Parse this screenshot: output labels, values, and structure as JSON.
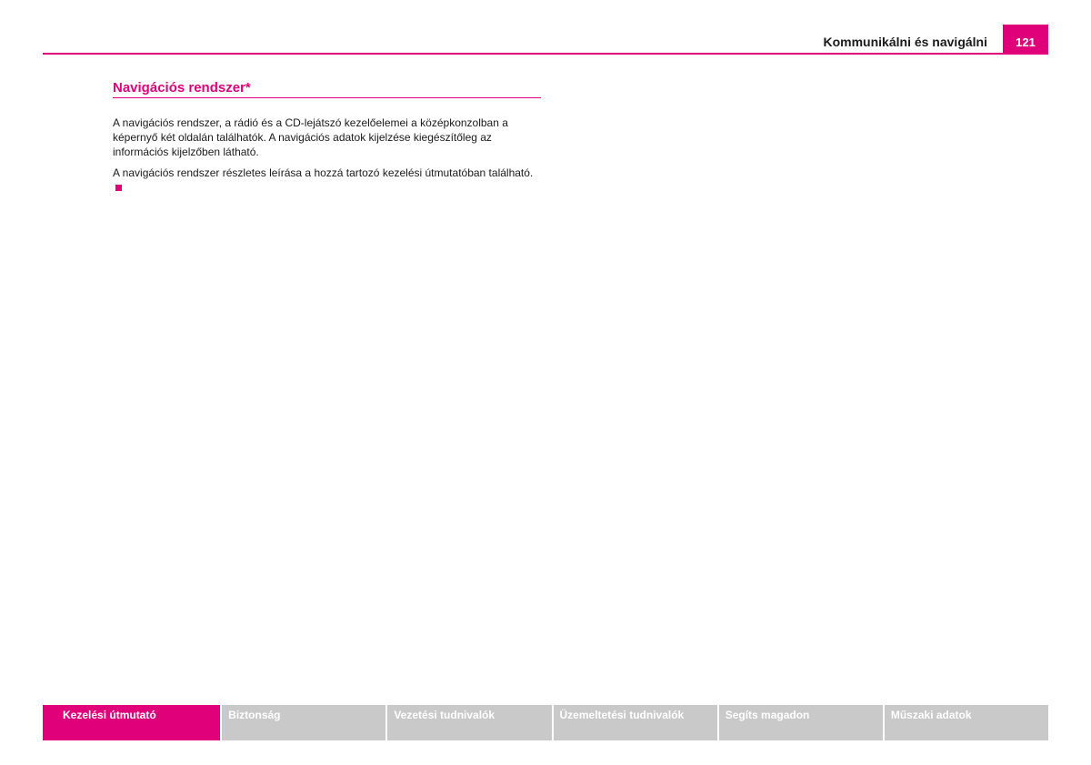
{
  "header": {
    "chapter_title": "Kommunikálni és navigálni",
    "page_number": "121",
    "accent_color": "#e0007a"
  },
  "section": {
    "heading": "Navigációs rendszer*",
    "paragraphs": [
      "A navigációs rendszer, a rádió és a CD-lejátszó kezelőelemei a középkonzolban a képernyő két oldalán találhatók. A navigációs adatok kijelzése kiegészítőleg az információs kijelzőben látható.",
      "A navigációs rendszer részletes leírása a hozzá tartozó kezelési útmutatóban található."
    ]
  },
  "footer_nav": {
    "tabs": [
      {
        "label": "Kezelési útmutató",
        "active": true
      },
      {
        "label": "Biztonság",
        "active": false
      },
      {
        "label": "Vezetési tudnivalók",
        "active": false
      },
      {
        "label": "Üzemeltetési tudnivalók",
        "active": false
      },
      {
        "label": "Segíts magadon",
        "active": false
      },
      {
        "label": "Műszaki adatok",
        "active": false
      }
    ]
  }
}
